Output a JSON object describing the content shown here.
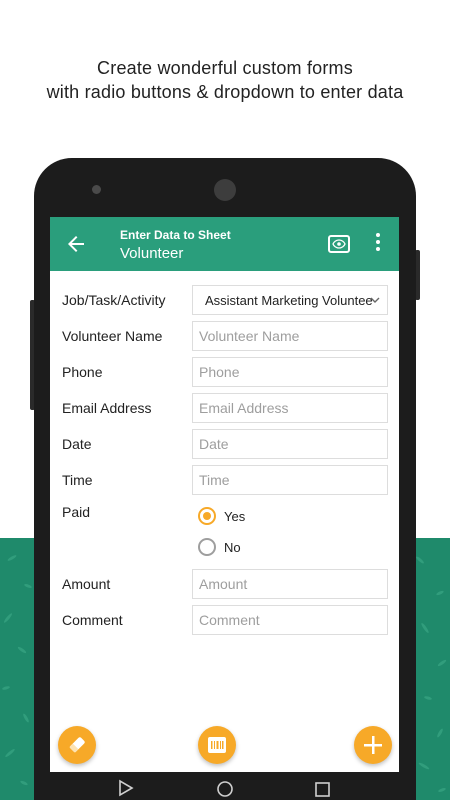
{
  "headline": {
    "line1": "Create wonderful custom forms",
    "line2": "with radio buttons & dropdown to enter data"
  },
  "appbar": {
    "title": "Enter Data to Sheet",
    "subtitle": "Volunteer",
    "icons": [
      "arrow-left-icon",
      "eye-icon",
      "more-vert-icon"
    ]
  },
  "colors": {
    "primary": "#2a9e7c",
    "accent": "#f7a928",
    "background_band": "#1f8a6b"
  },
  "form": {
    "job": {
      "label": "Job/Task/Activity",
      "value": "Assistant Marketing Volunteer"
    },
    "volunteer_name": {
      "label": "Volunteer Name",
      "placeholder": "Volunteer Name",
      "value": ""
    },
    "phone": {
      "label": "Phone",
      "placeholder": "Phone",
      "value": ""
    },
    "email": {
      "label": "Email Address",
      "placeholder": "Email Address",
      "value": ""
    },
    "date": {
      "label": "Date",
      "placeholder": "Date",
      "value": ""
    },
    "time": {
      "label": "Time",
      "placeholder": "Time",
      "value": ""
    },
    "paid": {
      "label": "Paid",
      "options": [
        {
          "label": "Yes",
          "checked": true
        },
        {
          "label": "No",
          "checked": false
        }
      ]
    },
    "amount": {
      "label": "Amount",
      "placeholder": "Amount",
      "value": ""
    },
    "comment": {
      "label": "Comment",
      "placeholder": "Comment",
      "value": ""
    }
  },
  "fabs": [
    "eraser-icon",
    "barcode-scan-icon",
    "add-icon"
  ],
  "navbar": [
    "nav-back-icon",
    "nav-home-icon",
    "nav-recents-icon"
  ]
}
